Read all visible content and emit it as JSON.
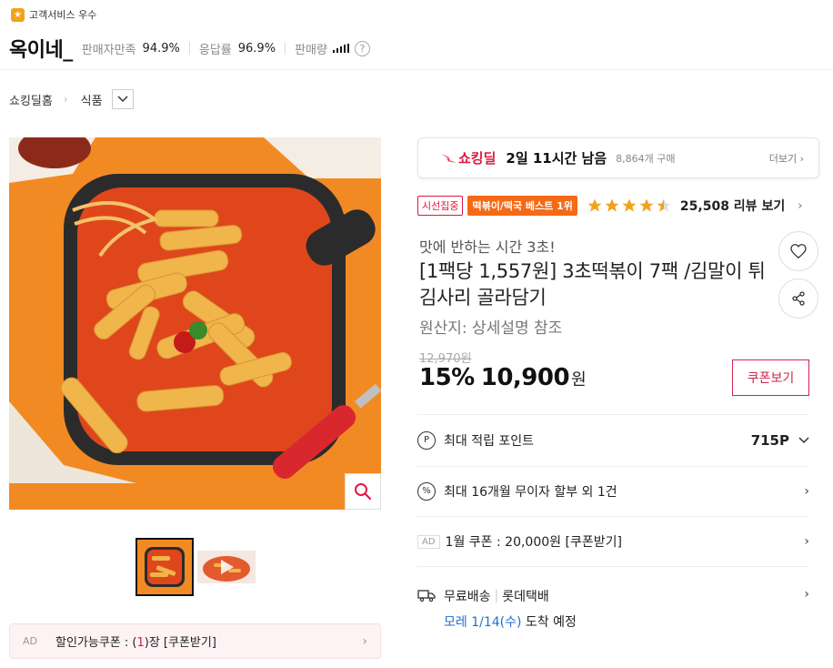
{
  "seller": {
    "badge": "고객서비스 우수",
    "name": "옥이네_",
    "satisfaction_label": "판매자만족",
    "satisfaction_value": "94.9%",
    "response_label": "응답률",
    "response_value": "96.9%",
    "sales_label": "판매량"
  },
  "breadcrumb": {
    "home": "쇼킹딜홈",
    "category": "식품"
  },
  "deal": {
    "logo": "쇼킹딜",
    "remaining": "2일 11시간 남음",
    "purchased": "8,864개 구매",
    "more": "더보기"
  },
  "tags": {
    "focus": "시선집중",
    "best": "떡볶이/떡국 베스트 1위"
  },
  "rating": {
    "stars": 4.5,
    "review_text": "25,508 리뷰 보기"
  },
  "product": {
    "subtitle": "맛에 반하는 시간 3초!",
    "title": "[1팩당 1,557원] 3초떡볶이 7팩 /김말이 튀김사리 골라담기",
    "origin": "원산지: 상세설명 참조",
    "original_price": "12,970원",
    "discount": "15%",
    "price": "10,900",
    "currency": "원",
    "coupon_button": "쿠폰보기"
  },
  "benefits": {
    "point_icon": "P",
    "point_label": "최대 적립 포인트",
    "point_value": "715P",
    "installment_icon": "%",
    "installment_label": "최대 16개월 무이자 할부 외 1건",
    "coupon_ad": "AD",
    "coupon_label": "1월 쿠폰 : 20,000원 [쿠폰받기]",
    "shipping_free": "무료배송",
    "shipping_carrier": "롯데택배",
    "shipping_date": "모레 1/14(수)",
    "shipping_suffix": "도착 예정"
  },
  "coupon_bar": {
    "ad": "AD",
    "text_prefix": "할인가능쿠폰 : (",
    "count": "1",
    "text_suffix": ")장 [쿠폰받기]"
  },
  "colors": {
    "accent": "#e1173f",
    "star": "#f0a31b",
    "best_tag": "#f56a16",
    "shipping_blue": "#1f6fd1"
  }
}
